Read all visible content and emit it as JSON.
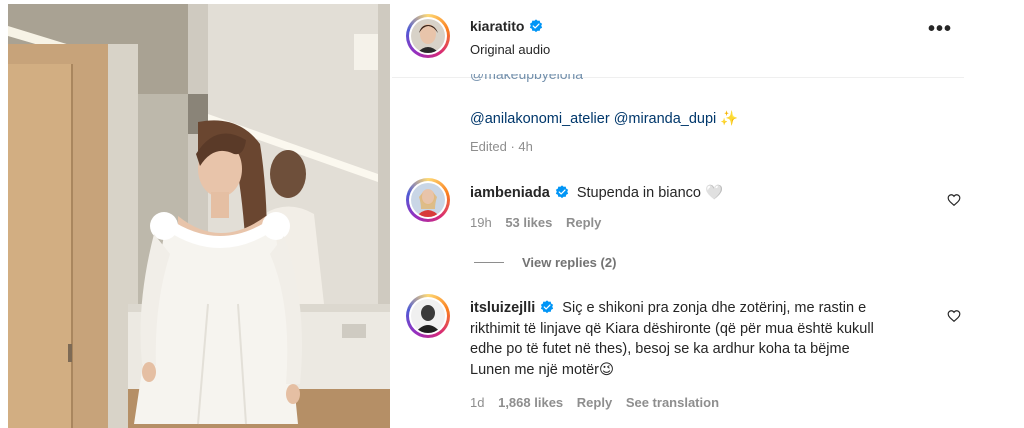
{
  "post": {
    "username": "kiaratito",
    "audio": "Original audio",
    "more_label": "•••",
    "cut_caption": "@makeupbyelona",
    "mentions": [
      "@anilakonomi_atelier",
      "@miranda_dupi"
    ],
    "mention_emoji": "✨",
    "edited": "Edited · 4h"
  },
  "comments": [
    {
      "username": "iambeniada",
      "text": "Stupenda in bianco 🤍",
      "time": "19h",
      "likes": "53 likes",
      "reply": "Reply",
      "view_replies": "View replies (2)"
    },
    {
      "username": "itsluizejlli",
      "text": "Siç e shikoni pra zonja dhe zotërinj, me rastin e rikthimit të linjave që Kiara dëshironte (që për mua është kukull edhe po të futet në thes), besoj se ka ardhur koha ta bëjme Lunen me një motër😉",
      "line1": "Siç e shikoni pra zonja dhe zotërinj, me rastin e",
      "line2": "rikthimit të linjave që Kiara dëshironte (që për mua është kukull",
      "line3": "edhe po të futet në thes), besoj se ka ardhur koha ta bëjme",
      "line4": "Lunen me një motër😉",
      "time": "1d",
      "likes": "1,868 likes",
      "reply": "Reply",
      "see_translation": "See translation"
    }
  ],
  "icons": {
    "verified": "verified-badge-icon",
    "heart": "heart-outline-icon",
    "more": "more-options-icon"
  },
  "colors": {
    "verified": "#0095f6",
    "link": "#00376b",
    "muted": "#8e8e8e"
  }
}
